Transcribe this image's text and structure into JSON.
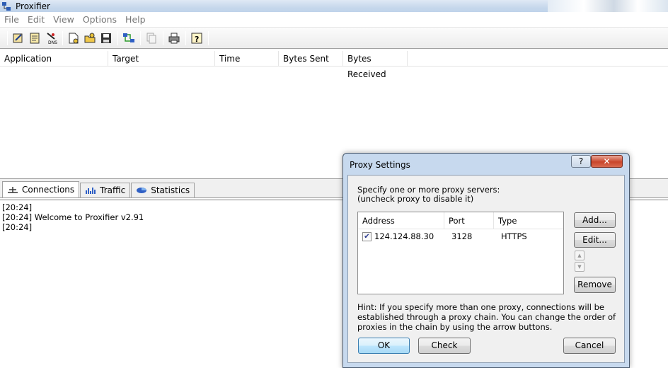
{
  "window": {
    "title": "Proxifier"
  },
  "menu": [
    "File",
    "Edit",
    "View",
    "Options",
    "Help"
  ],
  "toolbar_icons": [
    "profile-icon",
    "rules-icon",
    "dns-icon",
    "new-icon",
    "open-icon",
    "save-icon",
    "network-icon",
    "copy-icon",
    "print-icon",
    "help-icon"
  ],
  "connections": {
    "columns": [
      "Application",
      "Target",
      "Time",
      "Bytes Sent",
      "Bytes Received"
    ]
  },
  "tabs": [
    {
      "label": "Connections",
      "icon": "connections-icon"
    },
    {
      "label": "Traffic",
      "icon": "traffic-icon"
    },
    {
      "label": "Statistics",
      "icon": "statistics-icon"
    }
  ],
  "log": [
    {
      "time": "[20:24]",
      "text": ""
    },
    {
      "time": "[20:24]",
      "text": "Welcome to Proxifier v2.91"
    },
    {
      "time": "[20:24]",
      "text": ""
    }
  ],
  "dialog": {
    "title": "Proxy Settings",
    "help": "?",
    "description_line1": "Specify one or more proxy servers:",
    "description_line2": "(uncheck proxy to disable it)",
    "columns": [
      "Address",
      "Port",
      "Type"
    ],
    "proxies": [
      {
        "checked": true,
        "address": "124.124.88.30",
        "port": "3128",
        "type": "HTTPS"
      }
    ],
    "add": "Add...",
    "edit": "Edit...",
    "remove": "Remove",
    "hint": "Hint: If you specify more than one proxy, connections will be established through a proxy chain. You can change the order of proxies in the chain by using the arrow buttons.",
    "ok": "OK",
    "check": "Check",
    "cancel": "Cancel"
  }
}
